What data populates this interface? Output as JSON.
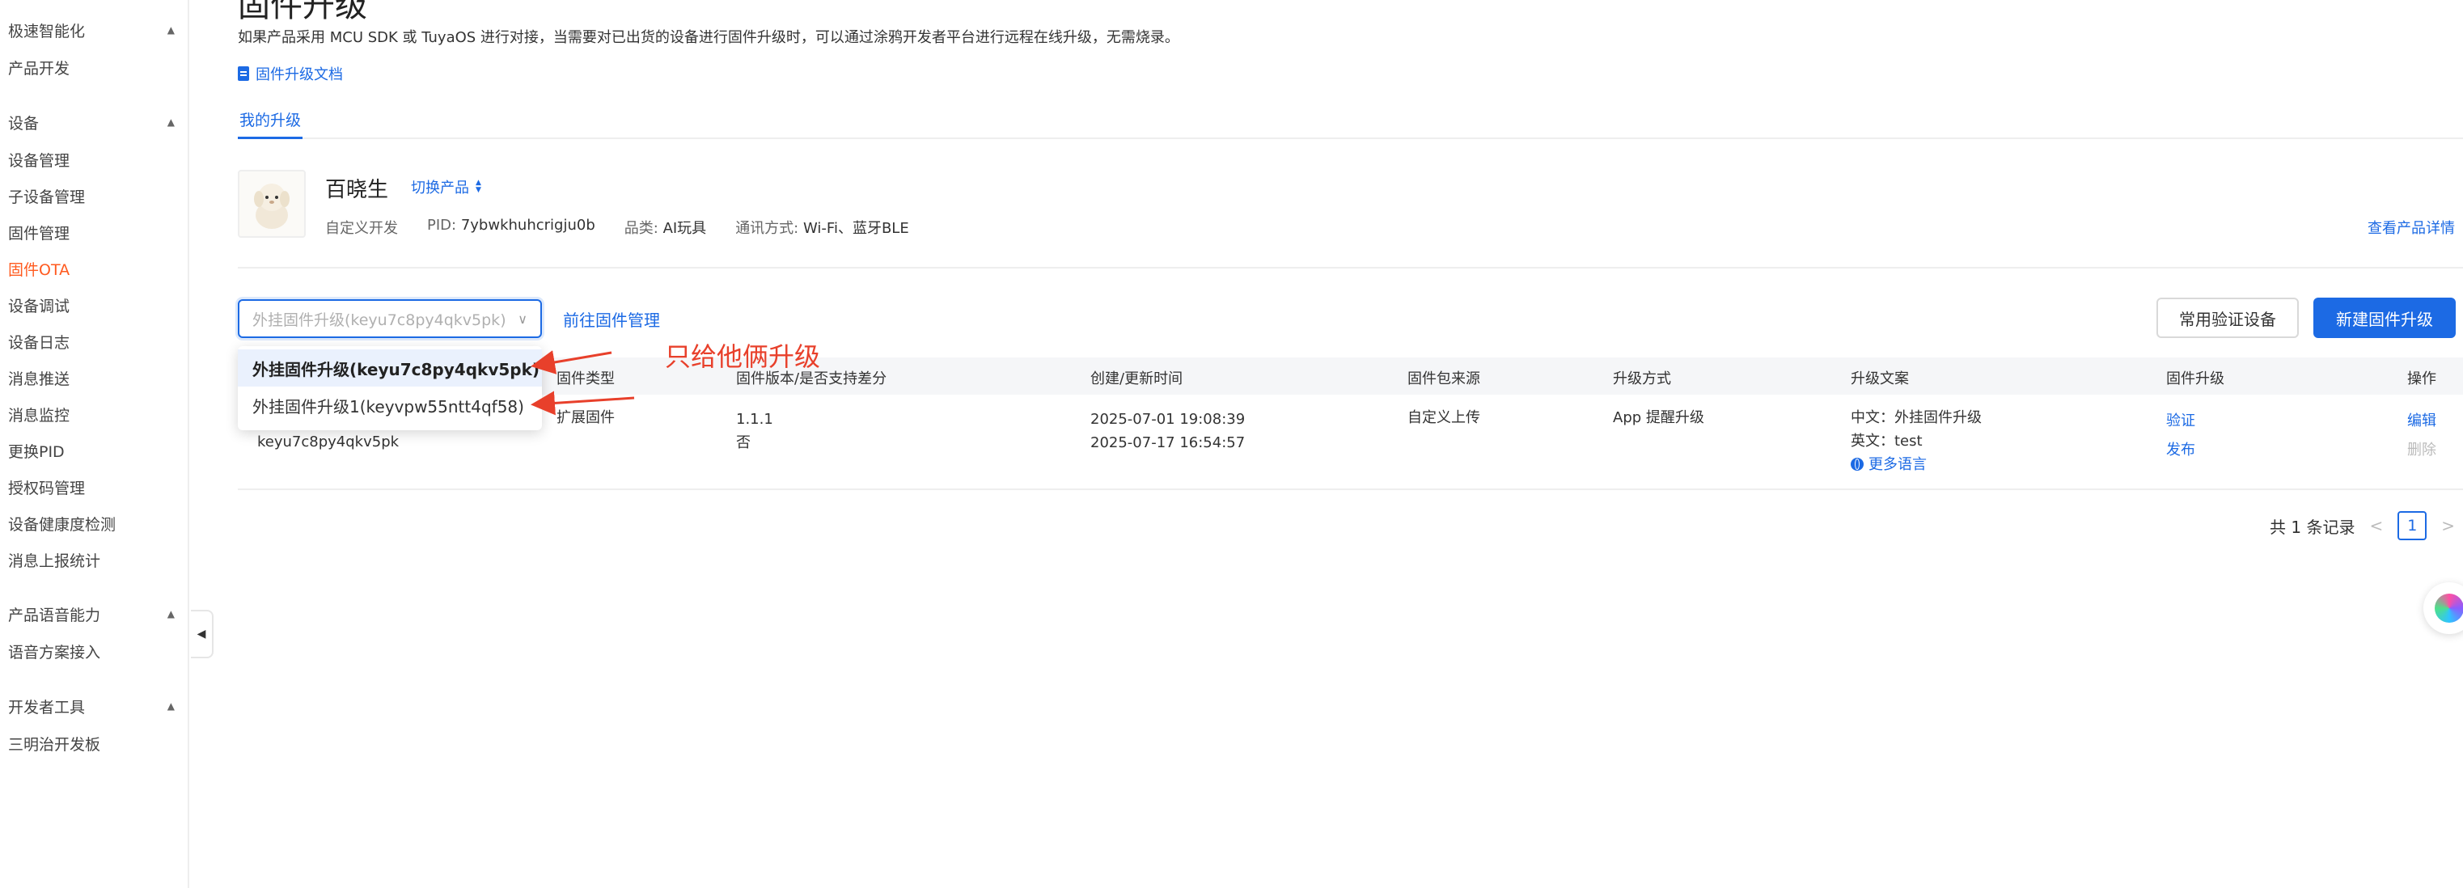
{
  "sidebar": {
    "groups": [
      {
        "label": "极速智能化",
        "items": [
          "产品开发"
        ]
      },
      {
        "label": "设备",
        "items": [
          "设备管理",
          "子设备管理",
          "固件管理",
          "固件OTA",
          "设备调试",
          "设备日志",
          "消息推送",
          "消息监控",
          "更换PID",
          "授权码管理",
          "设备健康度检测",
          "消息上报统计"
        ]
      },
      {
        "label": "产品语音能力",
        "items": [
          "语音方案接入"
        ]
      },
      {
        "label": "开发者工具",
        "items": [
          "三明治开发板"
        ]
      }
    ],
    "active_item": "固件OTA"
  },
  "header": {
    "title": "固件升级",
    "description": "如果产品采用 MCU SDK 或 TuyaOS 进行对接，当需要对已出货的设备进行固件升级时，可以通过涂鸦开发者平台进行远程在线升级，无需烧录。",
    "doc_link": "固件升级文档"
  },
  "tabs": [
    "我的升级"
  ],
  "product": {
    "name": "百晓生",
    "switch_label": "切换产品",
    "dev_mode": "自定义开发",
    "pid_label": "PID:",
    "pid_value": "7ybwkhuhcrigju0b",
    "category_label": "品类:",
    "category_value": "AI玩具",
    "comm_label": "通讯方式:",
    "comm_value": "Wi-Fi、蓝牙BLE",
    "detail_link": "查看产品详情"
  },
  "toolbar": {
    "select_placeholder": "外挂固件升级(keyu7c8py4qkv5pk)",
    "goto_link": "前往固件管理",
    "verify_button": "常用验证设备",
    "new_button": "新建固件升级"
  },
  "dropdown": {
    "options": [
      "外挂固件升级(keyu7c8py4qkv5pk)",
      "外挂固件升级1(keyvpw55ntt4qf58)"
    ]
  },
  "table": {
    "columns": [
      "固件类型",
      "固件版本/是否支持差分",
      "创建/更新时间",
      "固件包来源",
      "升级方式",
      "升级文案",
      "固件升级",
      "操作"
    ],
    "rows": [
      {
        "fw_key": "keyu7c8py4qkv5pk",
        "fw_type": "扩展固件",
        "version": "1.1.1",
        "diff": "否",
        "created": "2025-07-01 19:08:39",
        "updated": "2025-07-17 16:54:57",
        "source": "自定义上传",
        "method": "App 提醒升级",
        "text_cn": "中文：外挂固件升级",
        "text_en": "英文：test",
        "more_lang": "更多语言",
        "verify": "验证",
        "publish": "发布",
        "edit": "编辑",
        "delete": "删除"
      }
    ]
  },
  "pagination": {
    "total": "共 1 条记录",
    "current_page": "1"
  },
  "annotation": {
    "text": "只给他俩升级",
    "color": "#e8402b"
  },
  "colors": {
    "primary": "#1c6ae4",
    "active_nav": "#ff5a1f"
  }
}
